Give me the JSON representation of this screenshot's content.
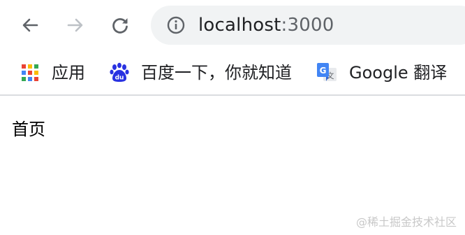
{
  "colors": {
    "icon_gray": "#5f6368",
    "icon_disabled": "#bdc1c6",
    "omnibox_bg": "#f1f3f4",
    "divider": "#dadce0",
    "baidu_blue": "#2932e1",
    "google_translate_blue": "#4285f4"
  },
  "toolbar": {
    "back_icon": "arrow-left-icon",
    "forward_icon": "arrow-right-icon",
    "reload_icon": "reload-icon",
    "info_icon": "info-icon",
    "url_host": "localhost",
    "url_port": ":3000"
  },
  "bookmarks": {
    "items": [
      {
        "label": "应用",
        "icon": "apps-grid-icon"
      },
      {
        "label": "百度一下，你就知道",
        "icon": "baidu-paw-icon"
      },
      {
        "label": "Google 翻译",
        "icon": "google-translate-icon"
      }
    ]
  },
  "page": {
    "heading": "首页"
  },
  "watermark": "@稀土掘金技术社区"
}
